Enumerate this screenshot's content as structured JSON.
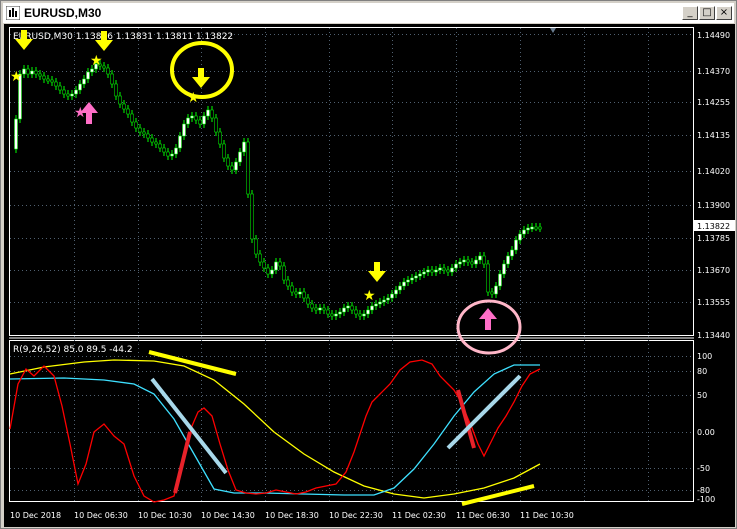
{
  "window": {
    "title": "EURUSD,M30",
    "buttons": {
      "minimize": "_",
      "maximize": "□",
      "close": "×"
    }
  },
  "main_panel": {
    "header": "EURUSD,M30  1.13816 1.13831 1.13811 1.13822",
    "price_labels": [
      "1.14490",
      "1.14370",
      "1.14255",
      "1.14135",
      "1.14020",
      "1.13900",
      "1.13785",
      "1.13670",
      "1.13555",
      "1.13440"
    ],
    "current_price": "1.13822"
  },
  "indicator_panel": {
    "header": "R(9,26,52) 85.0 89.5 -44.2",
    "level_labels": [
      "100",
      "80",
      "50",
      "0.00",
      "-50",
      "-80",
      "-100"
    ]
  },
  "time_labels": [
    "10 Dec 2018",
    "10 Dec 06:30",
    "10 Dec 10:30",
    "10 Dec 14:30",
    "10 Dec 18:30",
    "10 Dec 22:30",
    "11 Dec 02:30",
    "11 Dec 06:30",
    "11 Dec 10:30"
  ],
  "colors": {
    "chart_bg": "#000000",
    "bull_candle": "#ffffff",
    "bear_candle": "#000000",
    "candle_wick": "#00ff00",
    "grid": "#506070",
    "axis_text": "#ffffff",
    "series_red": "#ff0000",
    "series_cyan": "#3ee0ff",
    "series_yellow": "#ffff00",
    "annotation_yellow": "#ffff00",
    "annotation_pink": "#ff6ec7",
    "annotation_blue": "#a8d8ea",
    "annotation_red": "#e8222a"
  },
  "icons": {
    "down_arrow": "down-arrow-icon",
    "up_arrow": "up-arrow-icon",
    "star": "star-icon"
  }
}
